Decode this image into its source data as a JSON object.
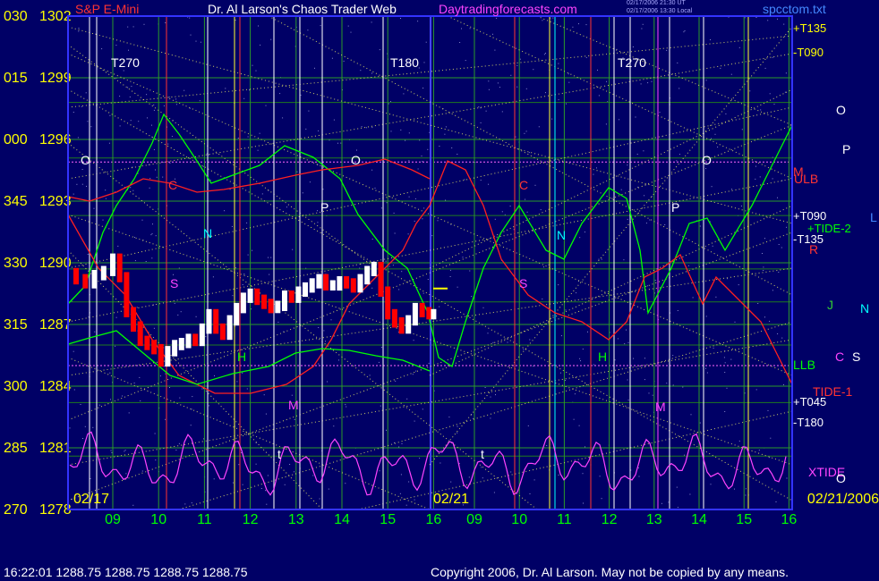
{
  "header": {
    "symbol": "S&P E-Mini",
    "title": "Dr. Al Larson's Chaos Trader Web",
    "site": "Daytradingforecasts.com",
    "stamp_lines": [
      "02/17/2006 21:30 UT",
      "02/17/2006 13:30 Local"
    ],
    "file": "spcctom.txt"
  },
  "footer": {
    "quote": "16:22:01  1288.75 1288.75 1288.75 1288.75",
    "copyright": "Copyright 2006, Dr. Al Larson. May not be copied by any means."
  },
  "colors": {
    "background": "#000066",
    "price_up": "#ffffff",
    "price_down": "#ff0000",
    "tide_1": "#ff2020",
    "tide_2": "#00ff00",
    "xtide": "#ff44ff",
    "planet_lines": "#ffff66",
    "pink_level": "#ff66ff"
  },
  "chart_data": {
    "type": "line",
    "ylim": [
      1278,
      1302
    ],
    "y_ticks_price": [
      "1302",
      "1299",
      "1296",
      "1293",
      "1290",
      "1287",
      "1284",
      "1281",
      "1278"
    ],
    "y_ticks_degree": [
      "030",
      "015",
      "000",
      "345",
      "330",
      "315",
      "300",
      "285",
      "270"
    ],
    "x_tick_labels": [
      "09",
      "10",
      "11",
      "12",
      "13",
      "14",
      "15",
      "16",
      "09",
      "10",
      "11",
      "12",
      "13",
      "14",
      "15",
      "16"
    ],
    "date_labels": [
      "02/17",
      "02/21",
      "02/21/2006"
    ],
    "right_labels": [
      "+T135",
      "-T090",
      "+T090",
      "-T135",
      "+T045",
      "-T180"
    ],
    "level_labels": [
      "ULB",
      "LLB"
    ],
    "series_labels": [
      "+TIDE-2",
      "TIDE-1",
      "XTIDE"
    ],
    "turn_labels": [
      "T270",
      "T180",
      "T270"
    ],
    "planet_letters": [
      "O",
      "P",
      "N",
      "S",
      "C",
      "M",
      "J",
      "H",
      "L",
      "R",
      "t"
    ],
    "last_price": 1288.75,
    "price_bars_02_17": [
      [
        8.0,
        1289.5
      ],
      [
        8.2,
        1289.2
      ],
      [
        8.4,
        1289.0
      ],
      [
        8.6,
        1289.4
      ],
      [
        8.8,
        1289.6
      ],
      [
        9.0,
        1290.2
      ],
      [
        9.15,
        1289.3
      ],
      [
        9.3,
        1287.6
      ],
      [
        9.45,
        1286.9
      ],
      [
        9.6,
        1286.2
      ],
      [
        9.75,
        1286.0
      ],
      [
        9.9,
        1285.8
      ],
      [
        10.05,
        1285.2
      ],
      [
        10.2,
        1285.7
      ],
      [
        10.35,
        1286.0
      ],
      [
        10.5,
        1286.1
      ],
      [
        10.65,
        1286.3
      ],
      [
        10.8,
        1286.2
      ],
      [
        10.95,
        1286.8
      ],
      [
        11.1,
        1287.5
      ],
      [
        11.25,
        1286.8
      ],
      [
        11.4,
        1286.5
      ],
      [
        11.55,
        1287.2
      ],
      [
        11.7,
        1287.8
      ],
      [
        11.85,
        1288.3
      ],
      [
        12.0,
        1288.5
      ],
      [
        12.15,
        1288.2
      ],
      [
        12.3,
        1288.0
      ],
      [
        12.45,
        1287.8
      ],
      [
        12.6,
        1287.9
      ],
      [
        12.75,
        1288.4
      ],
      [
        12.9,
        1288.3
      ],
      [
        13.05,
        1288.6
      ],
      [
        13.2,
        1288.8
      ],
      [
        13.35,
        1289.0
      ],
      [
        13.5,
        1289.2
      ],
      [
        13.65,
        1288.9
      ],
      [
        13.8,
        1288.9
      ],
      [
        13.95,
        1289.1
      ],
      [
        14.1,
        1289.0
      ],
      [
        14.25,
        1288.8
      ],
      [
        14.4,
        1289.2
      ],
      [
        14.55,
        1289.6
      ],
      [
        14.7,
        1289.8
      ],
      [
        14.85,
        1288.6
      ],
      [
        15.0,
        1287.5
      ],
      [
        15.15,
        1287.1
      ],
      [
        15.3,
        1286.8
      ],
      [
        15.45,
        1287.2
      ],
      [
        15.6,
        1287.8
      ],
      [
        15.75,
        1287.6
      ],
      [
        15.9,
        1287.5
      ],
      [
        16.0,
        1287.5
      ]
    ]
  }
}
